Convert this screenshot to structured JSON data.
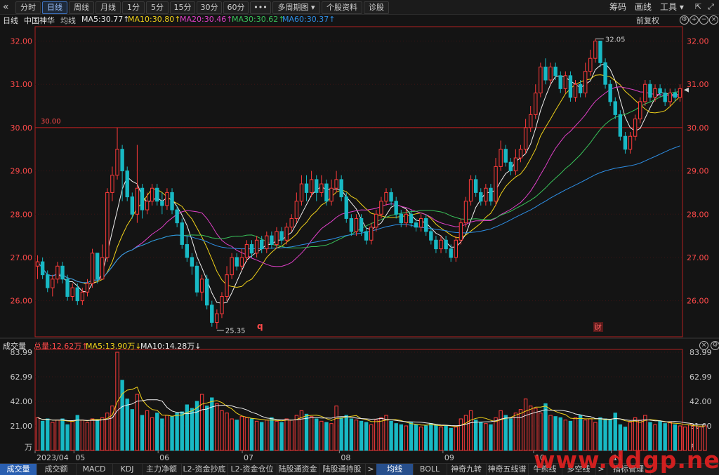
{
  "toolbar": {
    "back_icon": "«",
    "buttons": [
      {
        "label": "分时",
        "active": false
      },
      {
        "label": "日线",
        "active": true
      },
      {
        "label": "周线",
        "active": false
      },
      {
        "label": "月线",
        "active": false
      },
      {
        "label": "1分",
        "active": false
      },
      {
        "label": "5分",
        "active": false
      },
      {
        "label": "15分",
        "active": false
      },
      {
        "label": "30分",
        "active": false
      },
      {
        "label": "60分",
        "active": false
      },
      {
        "label": "•••",
        "active": false
      },
      {
        "label": "多周期图 ▾",
        "active": false
      },
      {
        "label": "个股资料",
        "active": false
      },
      {
        "label": "诊股",
        "active": false
      }
    ],
    "right": {
      "zhibiao": "筹码",
      "huaxian": "画线",
      "gongju": "工具 ▾"
    }
  },
  "info": {
    "period": "日线",
    "name": "中国神华",
    "avg_label": "均线",
    "ma5": "MA5:30.77↑",
    "ma10": "MA10:30.80↑",
    "ma20": "MA20:30.46↑",
    "ma30": "MA30:30.62↑",
    "ma60": "MA60:30.37↑",
    "fuquan": "前复权"
  },
  "volume_info": {
    "label": "成交量",
    "total": "总量:12.62万↑",
    "ma5": "MA5:13.90万↓",
    "ma10": "MA10:14.28万↓"
  },
  "bottom_tabs": [
    "成交量",
    "成交额",
    "MACD",
    "KDJ",
    "主力净额",
    "L2-资金抄底",
    "L2-资金仓位",
    "陆股通资金",
    "陆股通持股",
    ">",
    "均线",
    "BOLL",
    "神奇九转",
    "神奇五线谱",
    "牛熊线",
    "多空线",
    ">",
    "指标管理"
  ],
  "watermark": "www.ddgp.net",
  "colors": {
    "up": "#ff3b3b",
    "down": "#18b9c4",
    "ma5": "#f0f0f0",
    "ma10": "#f1d21a",
    "ma20": "#e040c8",
    "ma30": "#39c25a",
    "ma60": "#2e8fe6",
    "grid": "#b02020"
  },
  "chart_data": [
    {
      "type": "candlestick",
      "title": "日线",
      "y_ticks": [
        26.0,
        27.0,
        28.0,
        29.0,
        30.0,
        31.0,
        32.0
      ],
      "ylim": [
        25.2,
        32.3
      ],
      "x_ticks": [
        "2023/04",
        "05",
        "06",
        "07",
        "08",
        "09",
        "10",
        "11"
      ],
      "annotations": {
        "max": "32.05",
        "min": "25.35",
        "ref_line": "30.00",
        "marker_q": "q",
        "marker_cai": "财"
      },
      "candles": [
        [
          26.8,
          26.9,
          27.05,
          26.5
        ],
        [
          26.9,
          26.6,
          27.0,
          26.5
        ],
        [
          26.6,
          26.3,
          26.7,
          26.2
        ],
        [
          26.3,
          26.5,
          26.6,
          26.1
        ],
        [
          26.5,
          26.8,
          26.9,
          26.4
        ],
        [
          26.8,
          26.5,
          26.9,
          26.4
        ],
        [
          26.5,
          26.1,
          26.6,
          26.0
        ],
        [
          26.1,
          26.3,
          26.4,
          26.0
        ],
        [
          26.3,
          26.0,
          26.4,
          25.9
        ],
        [
          26.0,
          26.2,
          26.3,
          25.9
        ],
        [
          26.2,
          26.4,
          26.5,
          26.1
        ],
        [
          26.4,
          27.1,
          27.2,
          26.3
        ],
        [
          27.1,
          26.5,
          27.1,
          26.4
        ],
        [
          26.5,
          27.0,
          27.3,
          26.5
        ],
        [
          27.0,
          28.5,
          28.6,
          26.9
        ],
        [
          28.5,
          28.9,
          29.1,
          28.3
        ],
        [
          28.9,
          29.5,
          30.0,
          28.8
        ],
        [
          29.5,
          29.0,
          29.6,
          28.3
        ],
        [
          29.0,
          28.4,
          29.1,
          28.3
        ],
        [
          28.4,
          28.0,
          28.5,
          27.9
        ],
        [
          28.0,
          28.6,
          29.6,
          27.8
        ],
        [
          28.6,
          28.1,
          28.7,
          27.9
        ],
        [
          28.1,
          28.3,
          28.5,
          28.0
        ],
        [
          28.3,
          28.6,
          28.7,
          28.2
        ],
        [
          28.6,
          28.3,
          28.7,
          28.2
        ],
        [
          28.3,
          28.2,
          28.5,
          28.0
        ],
        [
          28.2,
          28.5,
          28.6,
          28.1
        ],
        [
          28.5,
          28.1,
          28.6,
          28.0
        ],
        [
          28.1,
          27.8,
          28.2,
          27.7
        ],
        [
          27.8,
          27.3,
          27.9,
          27.2
        ],
        [
          27.3,
          27.0,
          27.5,
          26.9
        ],
        [
          27.0,
          26.8,
          27.1,
          26.6
        ],
        [
          26.8,
          26.2,
          26.9,
          26.1
        ],
        [
          26.2,
          26.5,
          26.6,
          26.0
        ],
        [
          26.5,
          25.9,
          26.6,
          25.8
        ],
        [
          25.9,
          25.5,
          26.0,
          25.4
        ],
        [
          25.5,
          25.7,
          25.8,
          25.35
        ],
        [
          25.7,
          26.1,
          26.2,
          25.6
        ],
        [
          26.1,
          26.6,
          26.8,
          26.0
        ],
        [
          26.6,
          27.0,
          27.1,
          26.5
        ],
        [
          27.0,
          26.8,
          27.1,
          26.7
        ],
        [
          26.8,
          27.0,
          27.2,
          26.7
        ],
        [
          27.0,
          27.3,
          27.4,
          26.9
        ],
        [
          27.3,
          27.1,
          27.4,
          27.0
        ],
        [
          27.1,
          27.4,
          27.5,
          27.0
        ],
        [
          27.4,
          27.2,
          27.5,
          27.1
        ],
        [
          27.2,
          27.5,
          27.6,
          27.1
        ],
        [
          27.5,
          27.3,
          27.6,
          27.2
        ],
        [
          27.3,
          27.6,
          27.7,
          27.2
        ],
        [
          27.6,
          27.4,
          27.7,
          27.3
        ],
        [
          27.4,
          27.7,
          27.8,
          27.3
        ],
        [
          27.7,
          27.9,
          28.0,
          27.6
        ],
        [
          27.9,
          28.3,
          28.5,
          27.8
        ],
        [
          28.3,
          28.7,
          28.9,
          28.2
        ],
        [
          28.7,
          28.5,
          28.9,
          28.3
        ],
        [
          28.5,
          28.8,
          29.0,
          28.4
        ],
        [
          28.8,
          28.5,
          28.9,
          28.3
        ],
        [
          28.5,
          28.7,
          28.9,
          28.4
        ],
        [
          28.7,
          28.3,
          28.8,
          28.2
        ],
        [
          28.3,
          28.6,
          28.8,
          28.2
        ],
        [
          28.6,
          28.8,
          29.0,
          28.5
        ],
        [
          28.8,
          28.4,
          28.9,
          28.3
        ],
        [
          28.4,
          27.9,
          28.5,
          27.8
        ],
        [
          27.9,
          27.6,
          28.0,
          27.5
        ],
        [
          27.6,
          27.9,
          28.0,
          27.5
        ],
        [
          27.9,
          27.6,
          28.0,
          27.5
        ],
        [
          27.6,
          27.4,
          27.7,
          27.3
        ],
        [
          27.4,
          27.7,
          27.8,
          27.3
        ],
        [
          27.7,
          28.0,
          28.1,
          27.6
        ],
        [
          28.0,
          28.3,
          28.4,
          27.9
        ],
        [
          28.3,
          28.5,
          28.6,
          28.2
        ],
        [
          28.5,
          28.3,
          28.6,
          28.2
        ],
        [
          28.3,
          28.0,
          28.4,
          27.9
        ],
        [
          28.0,
          27.8,
          28.1,
          27.7
        ],
        [
          27.8,
          28.0,
          28.1,
          27.7
        ],
        [
          28.0,
          27.8,
          28.1,
          27.7
        ],
        [
          27.8,
          27.7,
          27.9,
          27.6
        ],
        [
          27.7,
          27.9,
          28.0,
          27.6
        ],
        [
          27.9,
          27.6,
          28.0,
          27.5
        ],
        [
          27.6,
          27.4,
          27.7,
          27.3
        ],
        [
          27.4,
          27.2,
          27.5,
          27.1
        ],
        [
          27.2,
          27.4,
          27.5,
          27.1
        ],
        [
          27.4,
          27.2,
          27.5,
          27.1
        ],
        [
          27.2,
          27.0,
          27.3,
          26.9
        ],
        [
          27.0,
          27.4,
          27.5,
          26.9
        ],
        [
          27.4,
          27.8,
          27.9,
          27.3
        ],
        [
          27.8,
          28.3,
          28.4,
          27.7
        ],
        [
          28.3,
          28.8,
          28.9,
          28.2
        ],
        [
          28.8,
          28.5,
          28.9,
          28.4
        ],
        [
          28.5,
          28.3,
          28.6,
          28.2
        ],
        [
          28.3,
          28.6,
          28.7,
          28.2
        ],
        [
          28.6,
          28.3,
          28.7,
          28.2
        ],
        [
          28.3,
          29.1,
          29.3,
          28.2
        ],
        [
          29.1,
          29.5,
          29.7,
          29.0
        ],
        [
          29.5,
          29.2,
          29.6,
          29.1
        ],
        [
          29.2,
          29.0,
          29.3,
          28.9
        ],
        [
          29.0,
          29.3,
          29.5,
          28.9
        ],
        [
          29.3,
          29.5,
          29.6,
          29.2
        ],
        [
          29.5,
          30.0,
          30.2,
          29.4
        ],
        [
          30.0,
          30.3,
          30.5,
          29.9
        ],
        [
          30.3,
          30.8,
          31.0,
          30.2
        ],
        [
          30.8,
          31.4,
          31.5,
          30.7
        ],
        [
          31.4,
          31.1,
          31.6,
          31.0
        ],
        [
          31.1,
          31.4,
          31.5,
          31.0
        ],
        [
          31.4,
          31.2,
          31.5,
          31.1
        ],
        [
          31.2,
          30.9,
          31.3,
          30.8
        ],
        [
          30.9,
          31.2,
          31.3,
          30.8
        ],
        [
          31.2,
          30.7,
          31.3,
          30.6
        ],
        [
          30.7,
          31.0,
          31.1,
          30.6
        ],
        [
          31.0,
          30.8,
          31.1,
          30.7
        ],
        [
          30.8,
          31.3,
          31.5,
          30.7
        ],
        [
          31.3,
          31.6,
          31.8,
          31.2
        ],
        [
          31.6,
          32.0,
          32.05,
          31.5
        ],
        [
          32.0,
          31.5,
          32.0,
          31.4
        ],
        [
          31.5,
          31.0,
          31.6,
          30.9
        ],
        [
          31.0,
          30.6,
          31.1,
          30.5
        ],
        [
          30.6,
          30.3,
          30.7,
          30.2
        ],
        [
          30.3,
          29.8,
          30.4,
          29.7
        ],
        [
          29.8,
          29.5,
          29.9,
          29.4
        ],
        [
          29.5,
          29.8,
          29.9,
          29.4
        ],
        [
          29.8,
          30.2,
          30.3,
          29.7
        ],
        [
          30.2,
          30.6,
          30.7,
          30.1
        ],
        [
          30.6,
          31.0,
          31.1,
          30.5
        ],
        [
          31.0,
          30.7,
          31.1,
          30.6
        ],
        [
          30.7,
          30.9,
          31.0,
          30.6
        ],
        [
          30.9,
          30.8,
          31.0,
          30.7
        ],
        [
          30.8,
          30.6,
          30.9,
          30.5
        ],
        [
          30.6,
          30.8,
          30.9,
          30.5
        ],
        [
          30.8,
          30.7,
          30.9,
          30.6
        ],
        [
          30.7,
          30.9,
          31.0,
          30.6
        ]
      ]
    },
    {
      "type": "bar",
      "title": "成交量",
      "y_ticks": [
        21.0,
        42.0,
        62.99,
        83.99
      ],
      "ylim": [
        0,
        84
      ],
      "unit": "万",
      "values": [
        28,
        25,
        27,
        24,
        26,
        27,
        22,
        25,
        30,
        26,
        24,
        27,
        26,
        28,
        32,
        38,
        84,
        60,
        44,
        35,
        48,
        30,
        34,
        28,
        32,
        27,
        30,
        29,
        32,
        33,
        39,
        36,
        42,
        48,
        38,
        45,
        40,
        34,
        32,
        27,
        26,
        29,
        28,
        27,
        25,
        24,
        26,
        28,
        25,
        24,
        27,
        26,
        30,
        34,
        31,
        29,
        27,
        25,
        24,
        23,
        38,
        28,
        30,
        27,
        26,
        25,
        24,
        22,
        26,
        28,
        30,
        25,
        23,
        22,
        21,
        24,
        22,
        20,
        21,
        23,
        22,
        20,
        21,
        19,
        20,
        27,
        30,
        34,
        26,
        24,
        23,
        22,
        28,
        34,
        30,
        27,
        32,
        35,
        44,
        38,
        36,
        32,
        40,
        30,
        29,
        28,
        26,
        25,
        28,
        30,
        26,
        27,
        24,
        28,
        27,
        26,
        32,
        22,
        20,
        24,
        28,
        26,
        30,
        24,
        22,
        25,
        23,
        24,
        22,
        21,
        20,
        22,
        21,
        20,
        21
      ]
    }
  ]
}
